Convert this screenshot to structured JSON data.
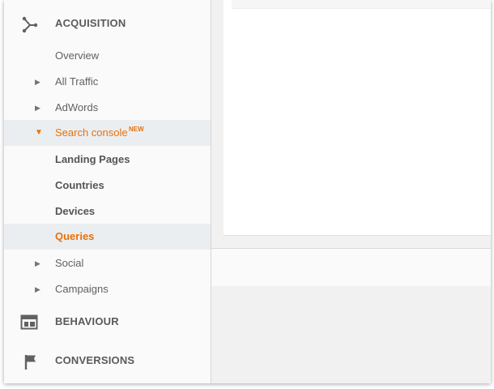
{
  "sidebar": {
    "acquisition": {
      "label": "ACQUISITION",
      "icon": "acquisition-icon",
      "items": [
        {
          "label": "Overview"
        },
        {
          "label": "All Traffic",
          "expandable": true
        },
        {
          "label": "AdWords",
          "expandable": true
        },
        {
          "label": "Search console",
          "badge": "NEW",
          "expanded": true,
          "active": true
        },
        {
          "label": "Landing Pages"
        },
        {
          "label": "Countries"
        },
        {
          "label": "Devices"
        },
        {
          "label": "Queries",
          "selected": true
        },
        {
          "label": "Social",
          "expandable": true
        },
        {
          "label": "Campaigns",
          "expandable": true
        }
      ]
    },
    "behaviour": {
      "label": "BEHAVIOUR",
      "icon": "behaviour-icon"
    },
    "conversions": {
      "label": "CONVERSIONS",
      "icon": "flag-icon"
    }
  },
  "colors": {
    "accent": "#e8710a",
    "active_bg": "#ebeef1",
    "sidebar_bg": "#fafafa",
    "text": "#616161"
  },
  "glyphs": {
    "collapsed": "▶",
    "expanded": "▼"
  }
}
